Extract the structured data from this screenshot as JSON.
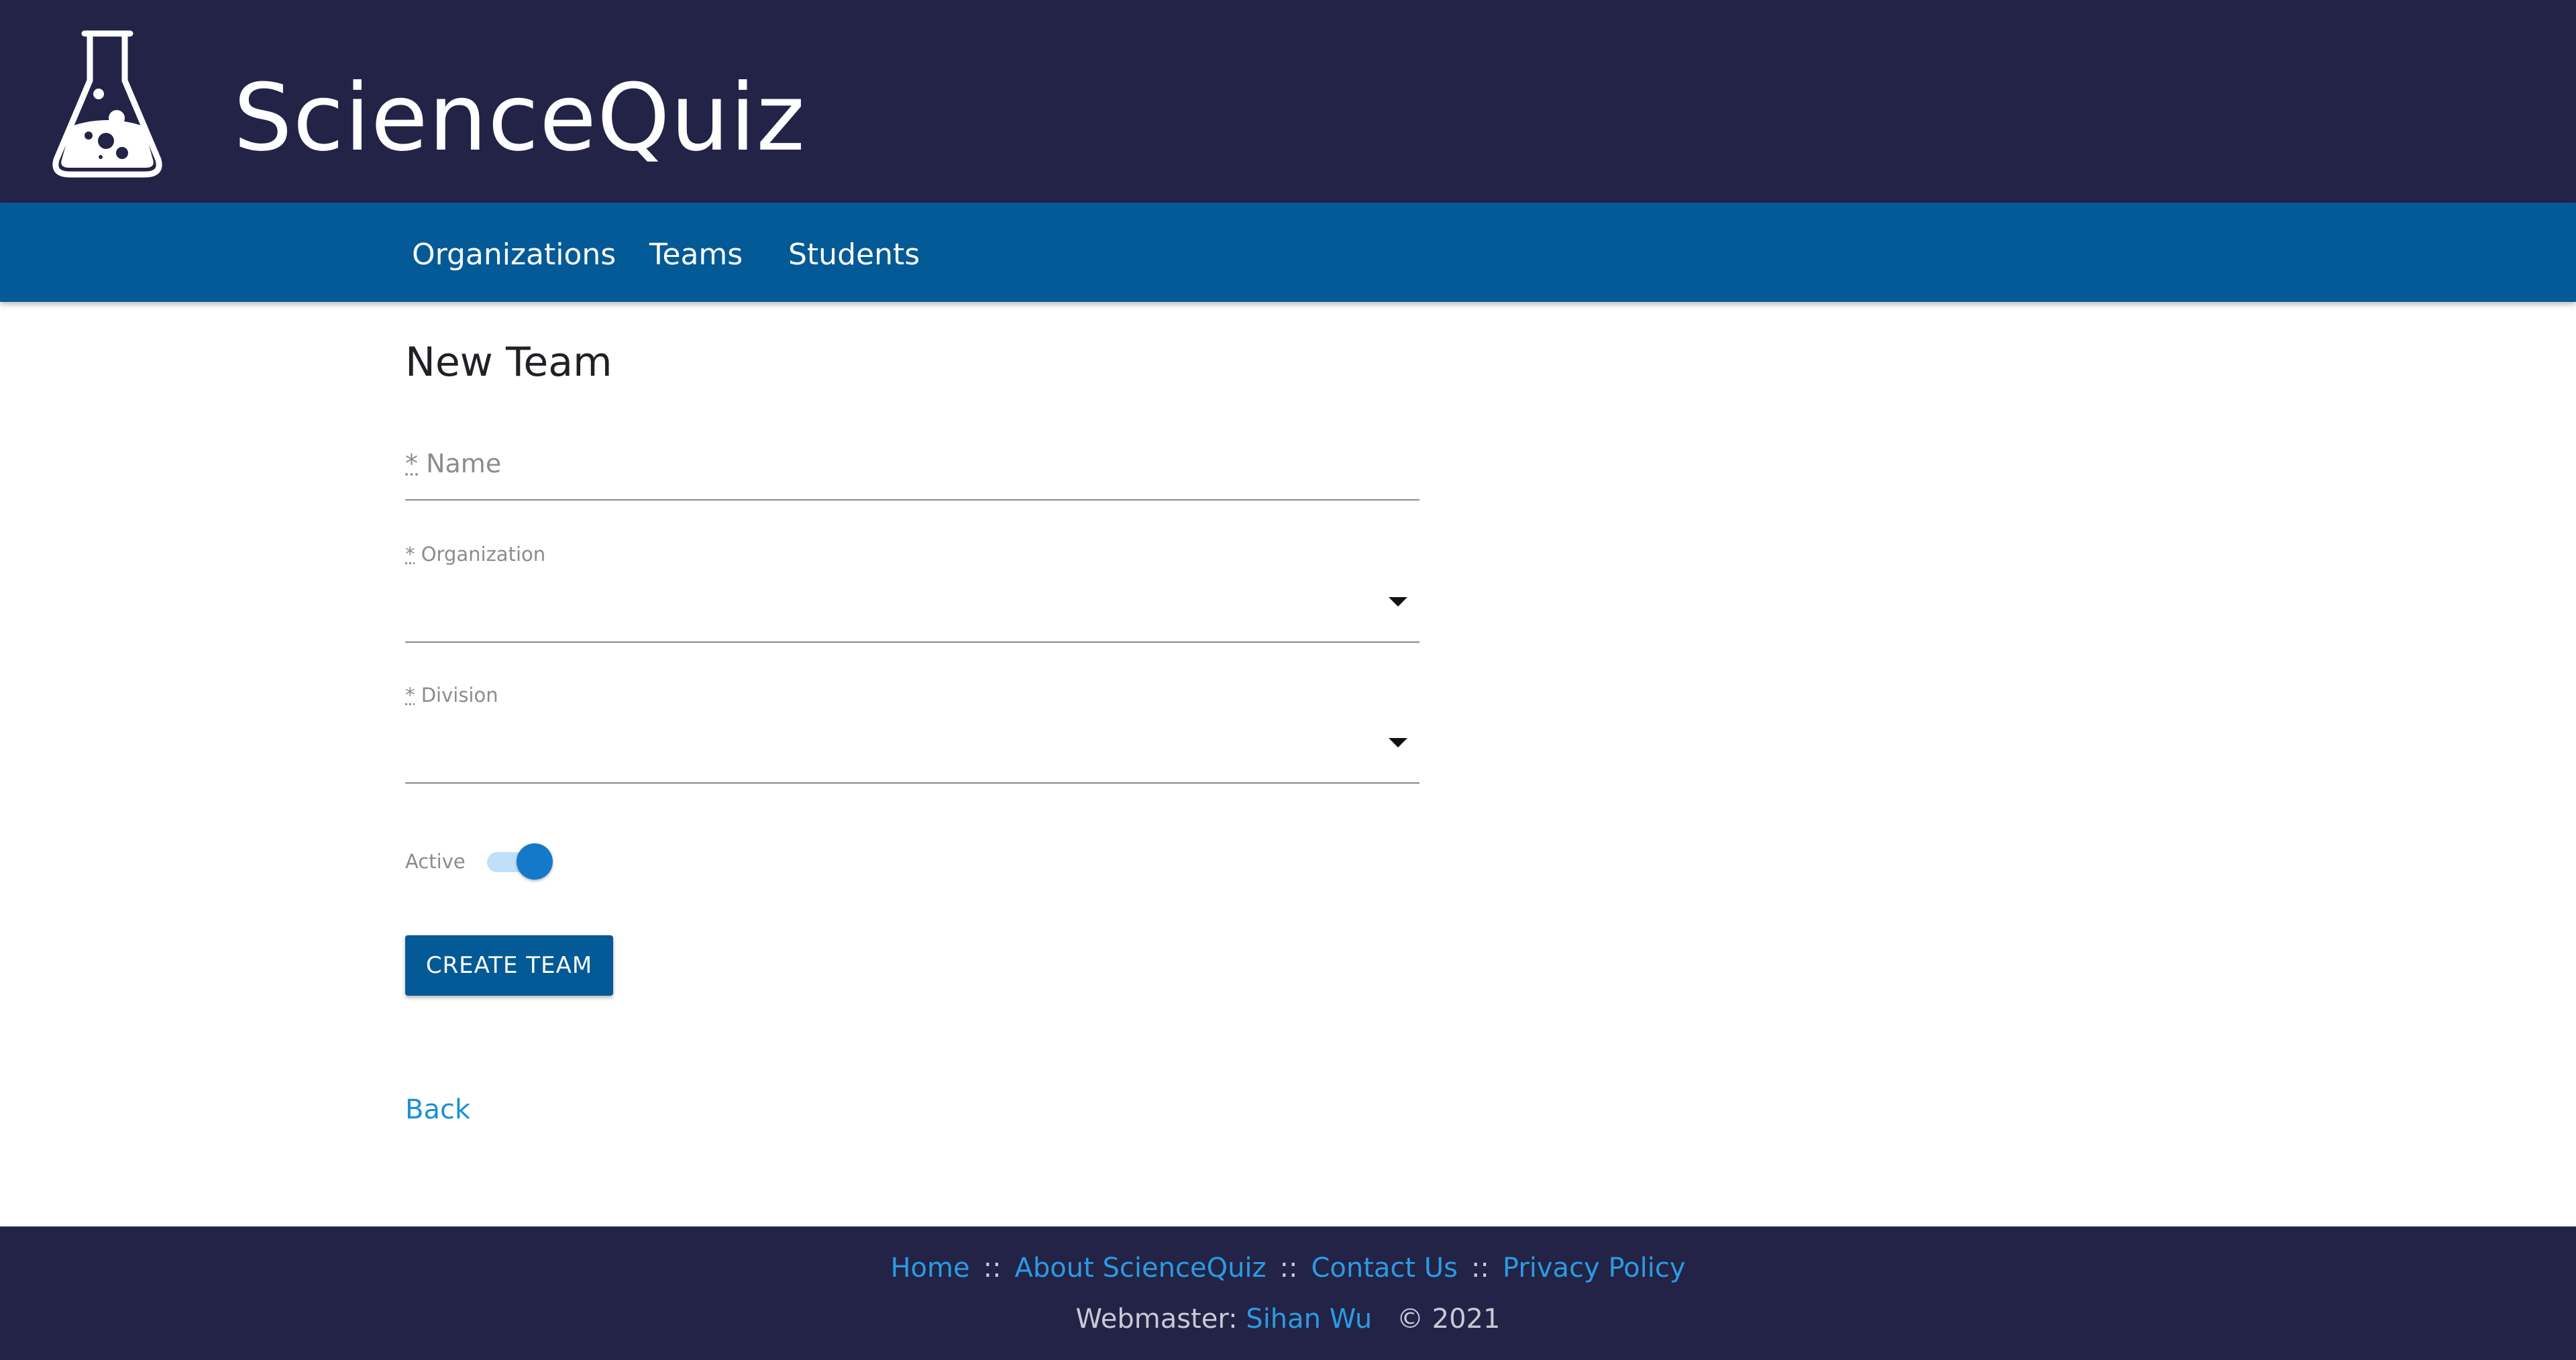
{
  "brand": {
    "name": "ScienceQuiz",
    "logo_icon": "flask-icon"
  },
  "nav": {
    "items": [
      {
        "label": "Organizations"
      },
      {
        "label": "Teams"
      },
      {
        "label": "Students"
      }
    ]
  },
  "form": {
    "title": "New Team",
    "required_marker": "*",
    "name": {
      "placeholder": "Name",
      "value": ""
    },
    "organization": {
      "label": "Organization",
      "value": "",
      "icon": "chevron-down-icon"
    },
    "division": {
      "label": "Division",
      "value": "",
      "icon": "chevron-down-icon"
    },
    "active": {
      "label": "Active",
      "on": true
    },
    "submit_label": "CREATE TEAM",
    "back_label": "Back"
  },
  "footer": {
    "links": [
      {
        "label": "Home"
      },
      {
        "label": "About ScienceQuiz"
      },
      {
        "label": "Contact Us"
      },
      {
        "label": "Privacy Policy"
      }
    ],
    "separator": "::",
    "webmaster_label": "Webmaster:",
    "webmaster_name": "Sihan Wu",
    "copyright": "© 2021"
  },
  "colors": {
    "header_bg": "#232347",
    "nav_bg": "#035a96",
    "accent": "#1479c9",
    "link": "#2b9be0"
  }
}
